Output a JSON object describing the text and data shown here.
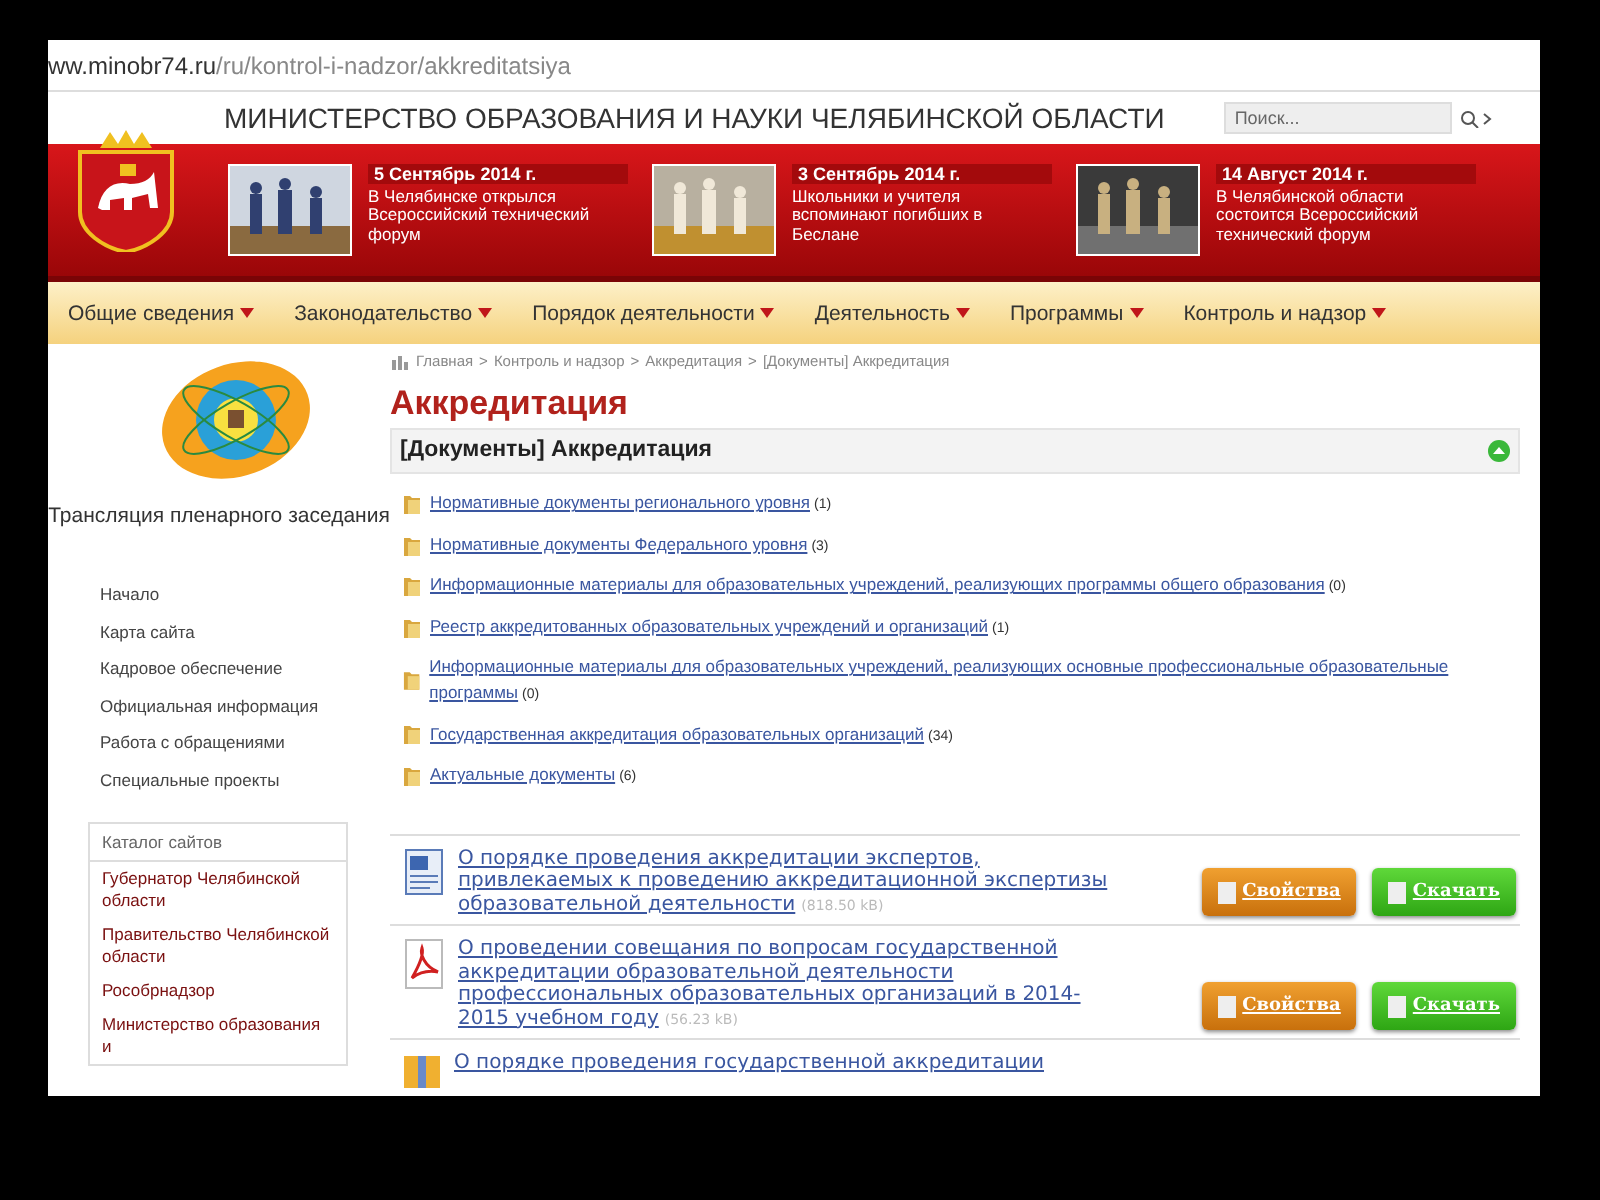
{
  "address_bar": {
    "url_host": "ww.minobr74.ru",
    "url_path": "/ru/kontrol-i-nadzor/akkreditatsiya"
  },
  "header": {
    "title": "МИНИСТЕРСТВО ОБРАЗОВАНИЯ И НАУКИ ЧЕЛЯБИНСКОЙ ОБЛАСТИ",
    "search": {
      "placeholder": "Поиск..."
    }
  },
  "news": [
    {
      "date": "5 Сентябрь 2014 г.",
      "text": "В Челябинске открылся Всероссийский технический форум"
    },
    {
      "date": "3 Сентябрь 2014 г.",
      "text": "Школьники и учителя вспоминают погибших в Беслане"
    },
    {
      "date": "14 Август 2014 г.",
      "text": "В Челябинской области состоится Всероссийский технический форум"
    }
  ],
  "nav": [
    {
      "label": "Общие сведения"
    },
    {
      "label": "Законодательство"
    },
    {
      "label": "Порядок деятельности"
    },
    {
      "label": "Деятельность"
    },
    {
      "label": "Программы"
    },
    {
      "label": "Контроль и надзор"
    }
  ],
  "breadcrumb": {
    "separator": ">",
    "items": [
      "Главная",
      "Контроль и надзор",
      "Аккредитация",
      "[Документы] Аккредитация"
    ]
  },
  "sidebar": {
    "broadcast": "Трансляция пленарного заседания",
    "links": [
      "Начало",
      "Карта сайта",
      "Кадровое обеспечение",
      "Официальная информация",
      "Работа с обращениями",
      "Специальные проекты"
    ],
    "catalog": {
      "title": "Каталог сайтов",
      "items": [
        "Губернатор Челябинской области",
        "Правительство Челябинской области",
        "Рособрнадзор",
        "Министерство образования и"
      ]
    }
  },
  "main": {
    "title": "Аккредитация",
    "section": "[Документы] Аккредитация",
    "categories": [
      {
        "label": "Нормативные документы регионального уровня",
        "count": "(1)"
      },
      {
        "label": "Нормативные документы Федерального уровня",
        "count": "(3)"
      },
      {
        "label": "Информационные материалы для образовательных учреждений, реализующих программы общего образования",
        "count": "(0)"
      },
      {
        "label": "Реестр аккредитованных образовательных учреждений и организаций",
        "count": "(1)"
      },
      {
        "label": "Информационные материалы для образовательных учреждений, реализующих основные профессиональные образовательные программы",
        "count": "(0)"
      },
      {
        "label": "Государственная аккредитация образовательных организаций",
        "count": "(34)"
      },
      {
        "label": "Актуальные документы",
        "count": "(6)"
      }
    ],
    "documents": [
      {
        "kind": "word",
        "title": "О порядке проведения аккредитации экспертов, привлекаемых к проведению аккредитационной экспертизы образовательной деятельности",
        "size": "(818.50 kB)",
        "buttons": [
          "Свойства",
          "Скачать"
        ]
      },
      {
        "kind": "pdf",
        "title": "О проведении совещания по вопросам государственной аккредитации образовательной деятельности профессиональных образовательных организаций в 2014-2015 учебном году",
        "size": "(56.23 kB)",
        "buttons": [
          "Свойства",
          "Скачать"
        ]
      },
      {
        "kind": "archive",
        "title": "О порядке проведения государственной аккредитации"
      }
    ]
  }
}
